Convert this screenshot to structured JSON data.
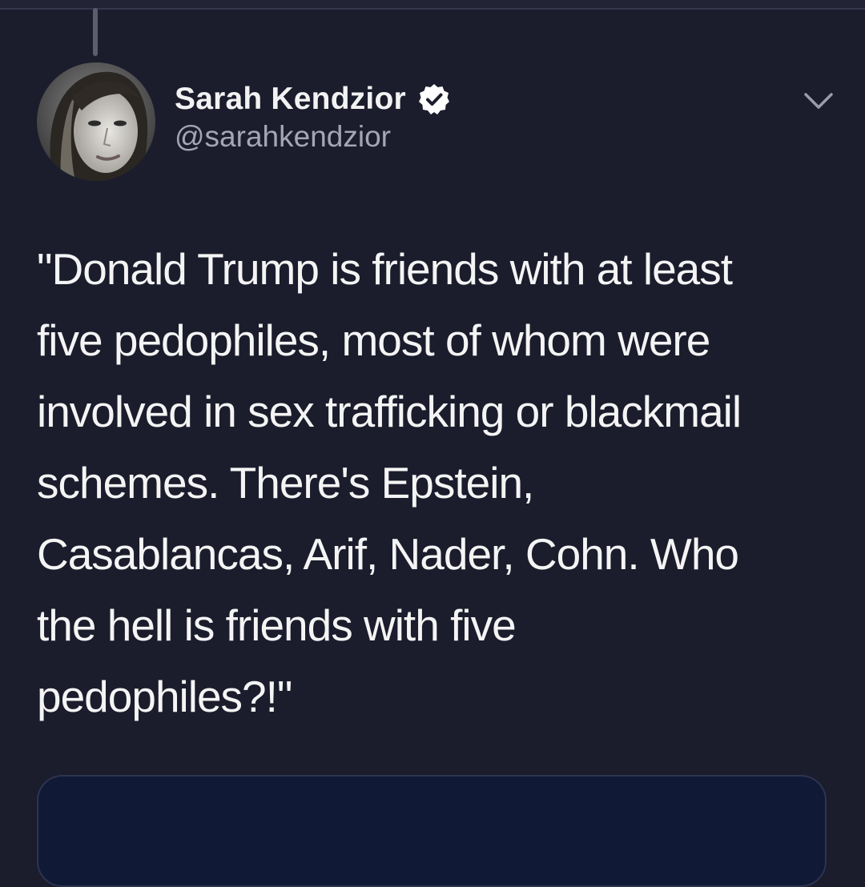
{
  "tweet": {
    "author": {
      "display_name": "Sarah Kendzior",
      "handle": "@sarahkendzior",
      "verified": true,
      "avatar_icon": "profile-photo"
    },
    "text": "\"Donald Trump is friends with at least\nfive pedophiles, most of whom were\ninvolved in sex trafficking or blackmail\nschemes. There's Epstein,\nCasablancas, Arif, Nader, Cohn. Who\nthe hell is friends with five\npedophiles?!\"",
    "menu_icon": "chevron-down-icon"
  },
  "colors": {
    "background": "#1b1c2c",
    "verified_badge": "#ffffff",
    "handle_text": "#a4a6b4",
    "card_background": "#101a36"
  }
}
